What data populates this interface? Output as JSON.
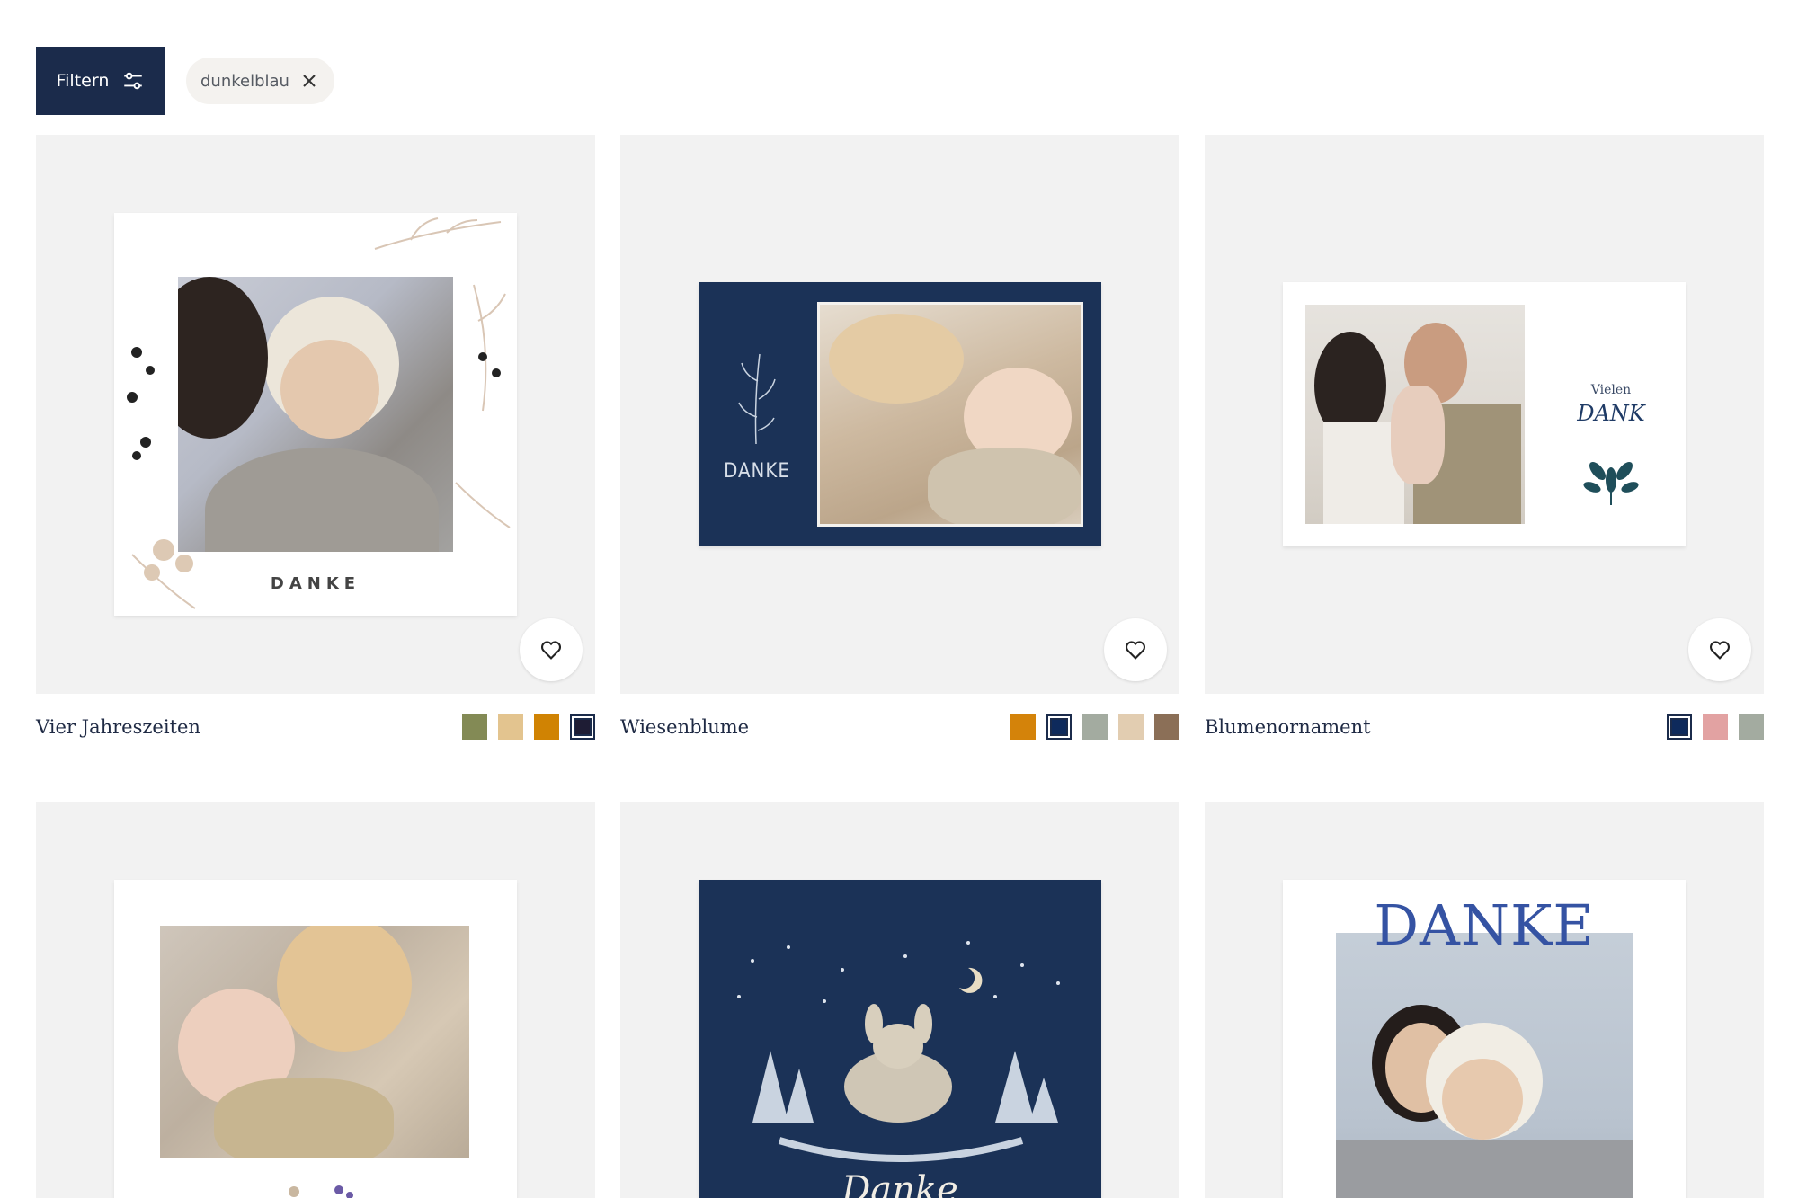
{
  "toolbar": {
    "filter_label": "Filtern",
    "active_filter": "dunkelblau"
  },
  "colors": {
    "navy": "#1b2b4b",
    "tile_bg": "#f2f2f2",
    "chip_bg": "#f4f2ef"
  },
  "products": [
    {
      "title": "Vier Jahreszeiten",
      "card_text": "DANKE",
      "swatches": [
        "#838a55",
        "#e3c48f",
        "#d08303",
        "#1e1c34"
      ],
      "selected_swatch": 3
    },
    {
      "title": "Wiesenblume",
      "card_text": "DANKE",
      "swatches": [
        "#d4830a",
        "#0e2a5c",
        "#a3aba0",
        "#e2cdb1",
        "#8b6f57"
      ],
      "selected_swatch": 1
    },
    {
      "title": "Blumenornament",
      "card_text_small": "Vielen",
      "card_text": "DANK",
      "swatches": [
        "#0e2a5c",
        "#e2a2a2",
        "#a3aba0"
      ],
      "selected_swatch": 0
    },
    {
      "title": ""
    },
    {
      "card_text": "Danke"
    },
    {
      "card_text": "DANKE"
    }
  ]
}
